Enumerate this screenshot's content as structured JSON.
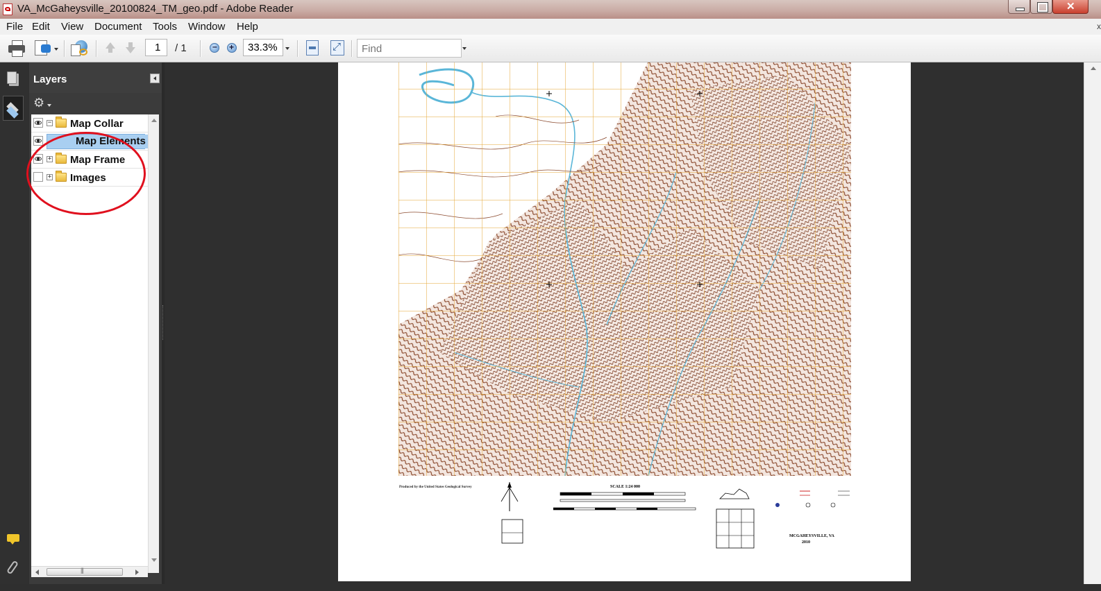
{
  "window": {
    "title": "VA_McGaheysville_20100824_TM_geo.pdf - Adobe Reader"
  },
  "menu": [
    "File",
    "Edit",
    "View",
    "Document",
    "Tools",
    "Window",
    "Help"
  ],
  "toolbar": {
    "page_current": "1",
    "page_total": "/ 1",
    "zoom": "33.3%",
    "find_placeholder": "Find"
  },
  "layers_panel": {
    "title": "Layers",
    "items": [
      {
        "label": "Map Collar",
        "visible": true,
        "expander": "−",
        "folder": true
      },
      {
        "label": "Map Elements",
        "visible": true,
        "expander": "",
        "folder": false,
        "selected": true
      },
      {
        "label": "Map Frame",
        "visible": true,
        "expander": "+",
        "folder": true
      },
      {
        "label": "Images",
        "visible": false,
        "expander": "+",
        "folder": true
      }
    ]
  },
  "document": {
    "quad_name": "MCGAHEYSVILLE, VA",
    "year": "2010",
    "scale": "SCALE 1:24 000",
    "producer": "Produced by the United States Geological Survey"
  },
  "colors": {
    "relief": "#8b4a2e",
    "grid": "#e6a530",
    "water": "#5ab6d8",
    "annotation": "#e0101e"
  }
}
